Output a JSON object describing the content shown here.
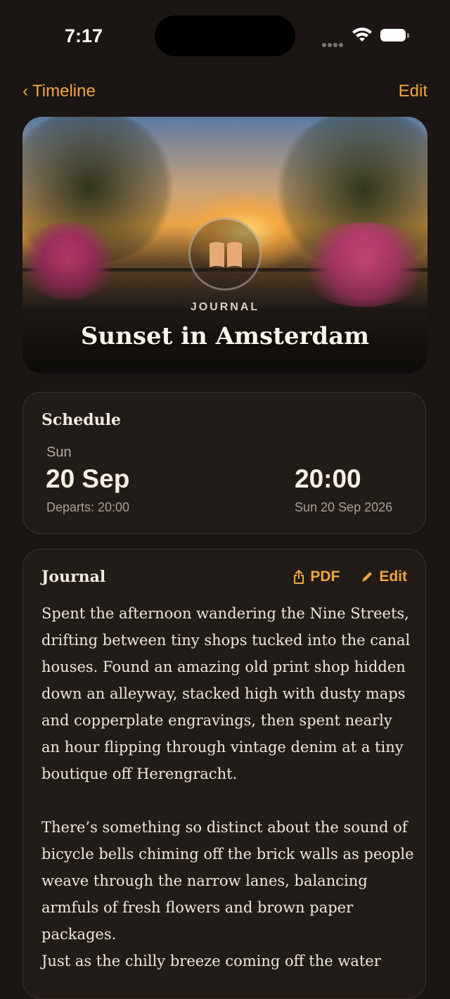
{
  "status": {
    "time": "7:17"
  },
  "nav": {
    "back_label": "Timeline",
    "edit_label": "Edit"
  },
  "hero": {
    "kicker": "JOURNAL",
    "title": "Sunset in Amsterdam"
  },
  "schedule": {
    "title": "Schedule",
    "day": "Sun",
    "date": "20 Sep",
    "departs": "Departs: 20:00",
    "time": "20:00",
    "full_date": "Sun 20 Sep 2026"
  },
  "journal": {
    "title": "Journal",
    "pdf_label": "PDF",
    "edit_label": "Edit",
    "paragraph1": "Spent the afternoon wandering the Nine Streets, drifting between tiny shops tucked into the canal houses. Found an amazing old print shop hidden down an alleyway, stacked high with dusty maps and copperplate engravings, then spent nearly an hour flipping through vintage denim at a tiny boutique off Herengracht.",
    "paragraph2": "There’s something so distinct about the sound of bicycle bells chiming off the brick walls as people weave through the narrow lanes, balancing armfuls of fresh flowers and brown paper packages.",
    "paragraph3": "Just as the chilly breeze coming off the water"
  },
  "icons": {
    "back": "chevron-left-icon",
    "book": "book-icon",
    "share": "share-icon",
    "pencil": "pencil-icon"
  },
  "colors": {
    "accent": "#f0a63f",
    "background": "#1b1613",
    "card": "#221c18"
  }
}
